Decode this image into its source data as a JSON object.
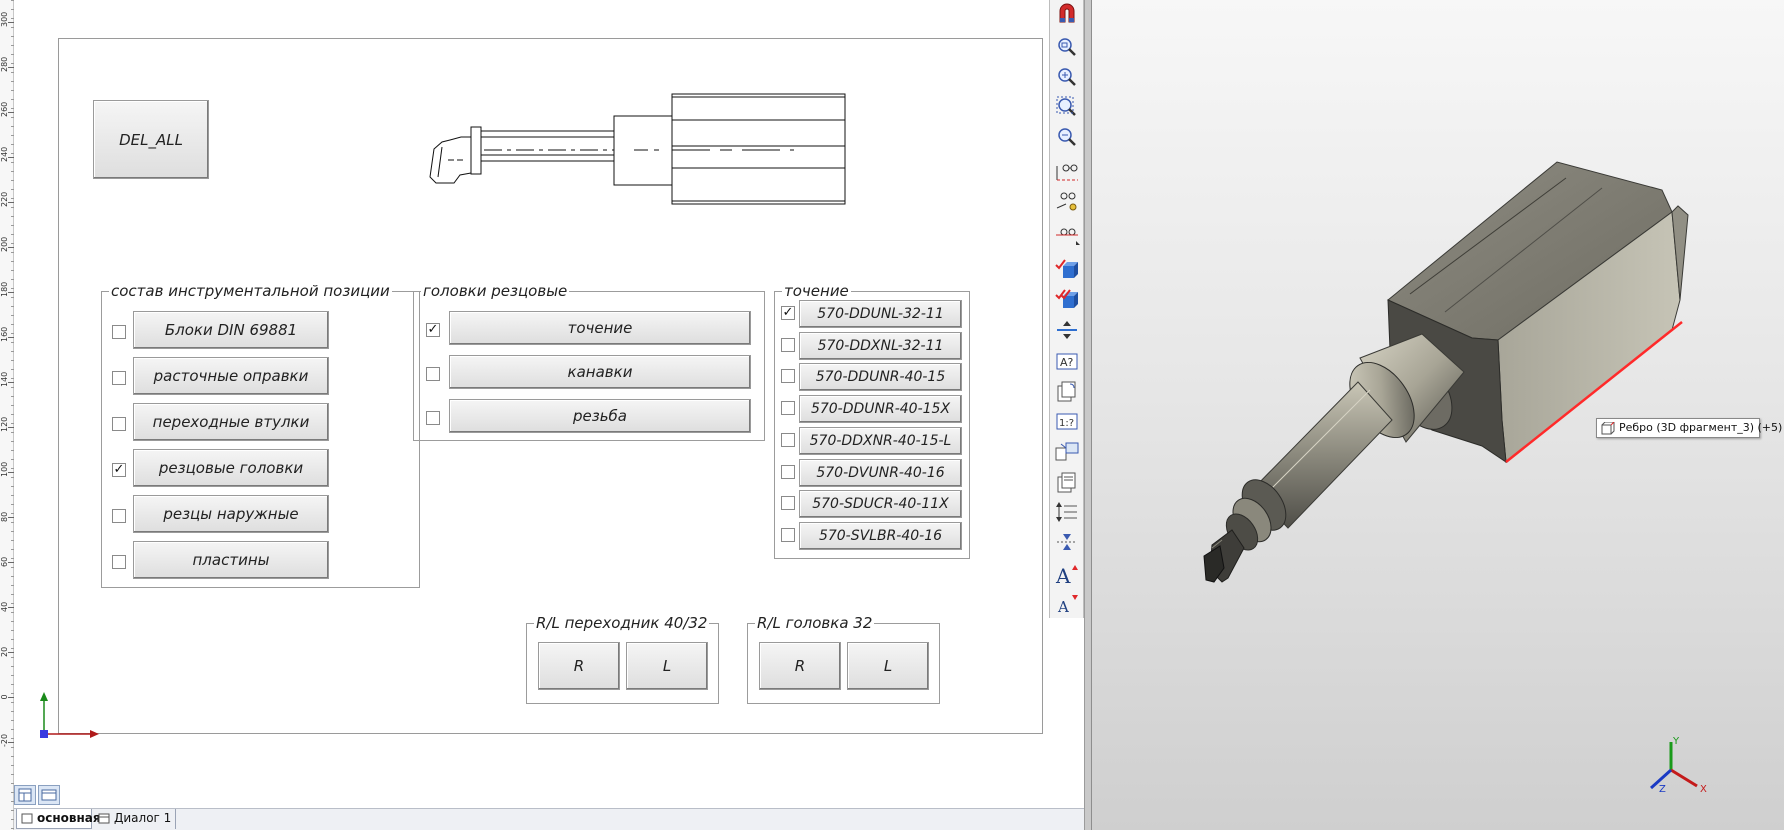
{
  "ruler": {
    "labels": [
      "300",
      "280",
      "260",
      "240",
      "220",
      "200",
      "180",
      "160",
      "140",
      "120",
      "100",
      "80",
      "60",
      "40",
      "20",
      "0",
      "-20"
    ]
  },
  "drawing": {
    "del_all_label": "DEL_ALL",
    "composition": {
      "title": "состав инструментальной позиции",
      "items": [
        {
          "label": "Блоки DIN 69881",
          "mark": ""
        },
        {
          "label": "расточные оправки",
          "mark": ""
        },
        {
          "label": "переходные втулки",
          "mark": ""
        },
        {
          "label": "резцовые головки",
          "mark": "✓"
        },
        {
          "label": "резцы наружные",
          "mark": ""
        },
        {
          "label": "пластины",
          "mark": ""
        }
      ]
    },
    "heads": {
      "title": "головки резцовые",
      "items": [
        {
          "label": "точение",
          "mark": "✓"
        },
        {
          "label": "канавки",
          "mark": ""
        },
        {
          "label": "резьба",
          "mark": ""
        }
      ]
    },
    "turning": {
      "title": "точение",
      "items": [
        {
          "label": "570-DDUNL-32-11",
          "mark": "✓"
        },
        {
          "label": "570-DDXNL-32-11",
          "mark": ""
        },
        {
          "label": "570-DDUNR-40-15",
          "mark": ""
        },
        {
          "label": "570-DDUNR-40-15X",
          "mark": ""
        },
        {
          "label": "570-DDXNR-40-15-L",
          "mark": ""
        },
        {
          "label": "570-DVUNR-40-16",
          "mark": ""
        },
        {
          "label": "570-SDUCR-40-11X",
          "mark": ""
        },
        {
          "label": "570-SVLBR-40-16",
          "mark": ""
        }
      ]
    },
    "adapter": {
      "title": "R/L переходник 40/32",
      "r_label": "R",
      "l_label": "L"
    },
    "head32": {
      "title": "R/L головка 32",
      "r_label": "R",
      "l_label": "L"
    }
  },
  "viewport": {
    "tooltip": "Ребро (3D фрагмент_3) (+5)",
    "triad": {
      "x": "X",
      "y": "Y",
      "z": "Z"
    },
    "highlight_color": "#ff2a2a"
  },
  "tabs": [
    {
      "label": "основная",
      "active": true
    },
    {
      "label": "Диалог 1",
      "active": false
    }
  ],
  "colors": {
    "accent": "#2f6fd0",
    "magnet_red": "#d22a2a",
    "check_red": "#e0282a"
  }
}
